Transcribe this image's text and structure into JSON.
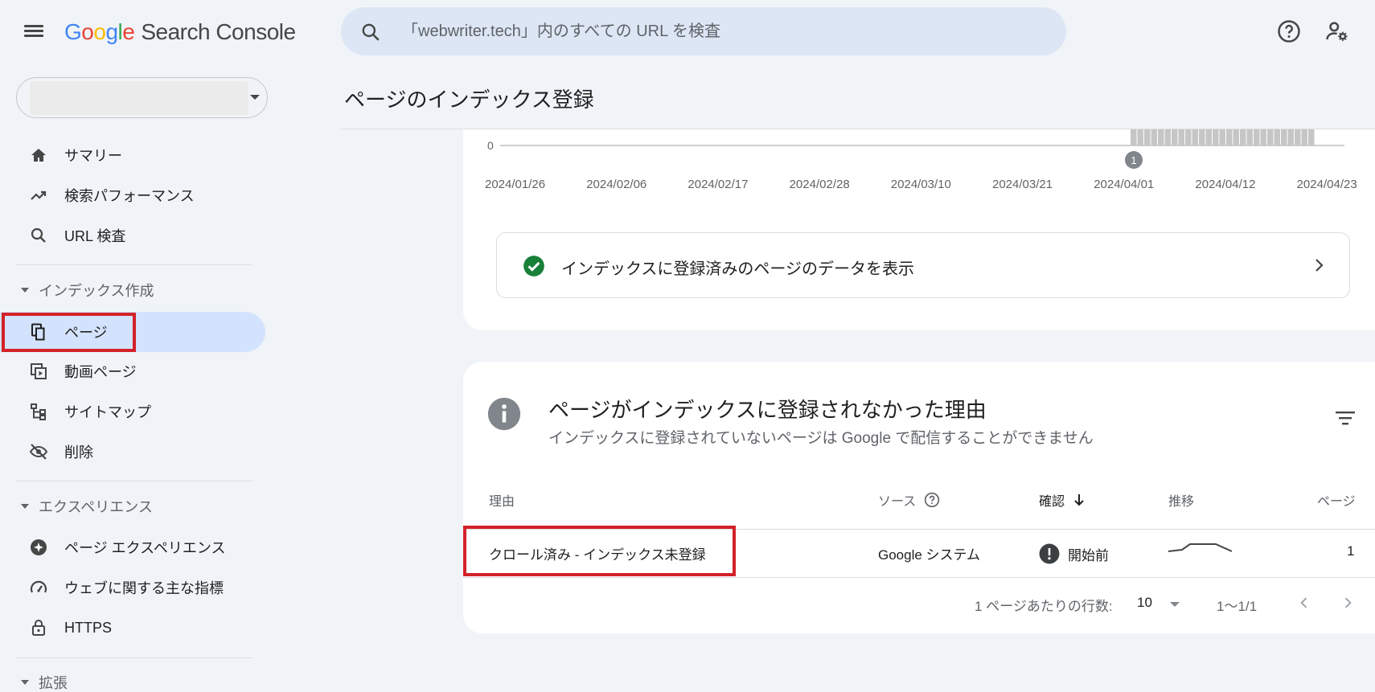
{
  "header": {
    "logo_google": [
      "G",
      "o",
      "o",
      "g",
      "l",
      "e"
    ],
    "product": "Search Console",
    "search_placeholder": "「webwriter.tech」内のすべての URL を検査"
  },
  "sidebar": {
    "items_top": [
      {
        "label": "サマリー",
        "icon": "home-icon"
      },
      {
        "label": "検索パフォーマンス",
        "icon": "trending-up-icon"
      },
      {
        "label": "URL 検査",
        "icon": "search-icon"
      }
    ],
    "section_indexing": "インデックス作成",
    "items_indexing": [
      {
        "label": "ページ",
        "icon": "pages-icon"
      },
      {
        "label": "動画ページ",
        "icon": "video-pages-icon"
      },
      {
        "label": "サイトマップ",
        "icon": "sitemap-icon"
      },
      {
        "label": "削除",
        "icon": "removals-icon"
      }
    ],
    "section_experience": "エクスペリエンス",
    "items_experience": [
      {
        "label": "ページ エクスペリエンス",
        "icon": "page-experience-icon"
      },
      {
        "label": "ウェブに関する主な指標",
        "icon": "speed-gauge-icon"
      },
      {
        "label": "HTTPS",
        "icon": "lock-icon"
      }
    ],
    "section_enhancements": "拡張"
  },
  "main": {
    "page_title": "ページのインデックス登録",
    "chart": {
      "zero_label": "0",
      "dates": [
        "2024/01/26",
        "2024/02/06",
        "2024/02/17",
        "2024/02/28",
        "2024/03/10",
        "2024/03/21",
        "2024/04/01",
        "2024/04/12",
        "2024/04/23"
      ],
      "marker_label": "1"
    },
    "view_indexed_link": "インデックスに登録済みのページのデータを表示",
    "reasons_card": {
      "title": "ページがインデックスに登録されなかった理由",
      "subtitle": "インデックスに登録されていないページは Google で配信することができません",
      "columns": {
        "reason": "理由",
        "source": "ソース",
        "validation": "確認",
        "trend": "推移",
        "pages": "ページ"
      },
      "rows": [
        {
          "reason": "クロール済み - インデックス未登録",
          "source": "Google システム",
          "validation": "開始前",
          "pages": "1"
        }
      ],
      "pager": {
        "rows_per_page_label": "1 ページあたりの行数:",
        "rows_per_page": "10",
        "range": "1〜1/1"
      }
    }
  },
  "chart_data": {
    "type": "bar",
    "x": [
      "2024/01/26",
      "2024/02/06",
      "2024/02/17",
      "2024/02/28",
      "2024/03/10",
      "2024/03/21",
      "2024/04/01",
      "2024/04/12",
      "2024/04/23"
    ],
    "ylim_label": "0",
    "title": "",
    "xlabel": "",
    "ylabel": ""
  },
  "colors": {
    "accent": "#0b57d0",
    "active_nav": "#d3e3fd",
    "success": "#188038",
    "highlight_border": "#d3222a"
  }
}
